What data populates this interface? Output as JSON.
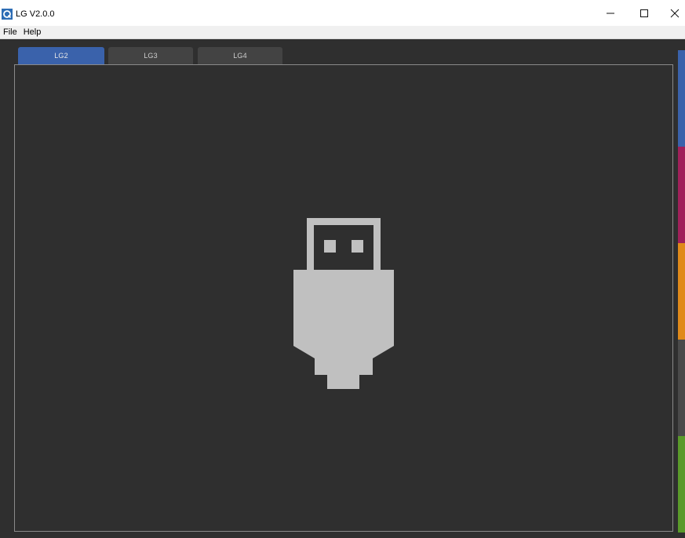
{
  "window": {
    "title": "LG V2.0.0",
    "controls": {
      "minimize": "–",
      "maximize": "☐",
      "close": "✕"
    }
  },
  "menu": {
    "items": [
      {
        "label": "File"
      },
      {
        "label": "Help"
      }
    ]
  },
  "tabs": [
    {
      "label": "LG2",
      "active": true
    },
    {
      "label": "LG3",
      "active": false
    },
    {
      "label": "LG4",
      "active": false
    }
  ],
  "main": {
    "icon": "usb-disconnected-icon"
  },
  "colors": {
    "accent": "#3a62ab",
    "panel_bg": "#2f2f2f",
    "icon_fill": "#c0c0c0",
    "status_strip": [
      "#3a62ab",
      "#a0205a",
      "#e08a1a",
      "#4a4a4a",
      "#5a9a2a"
    ]
  }
}
